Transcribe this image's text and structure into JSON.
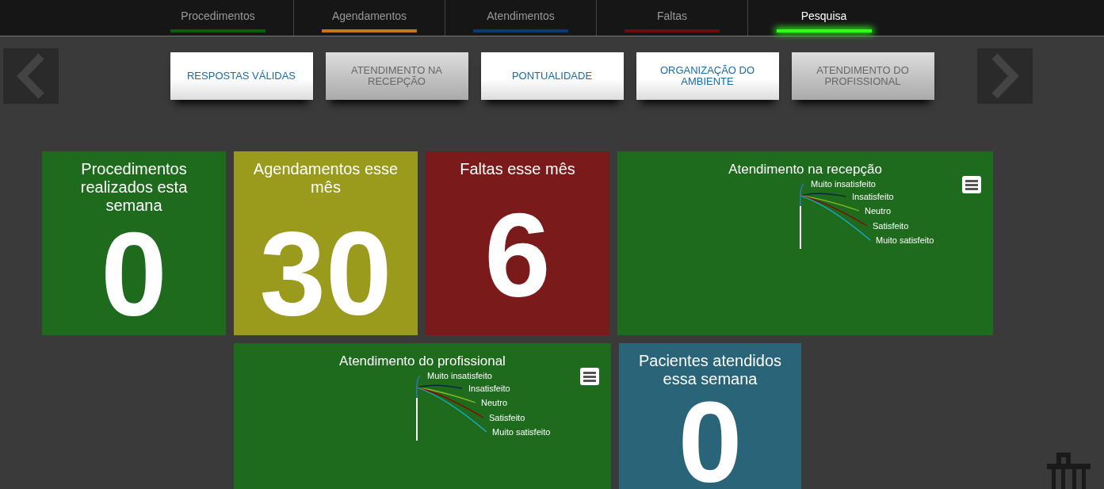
{
  "nav": {
    "tabs": [
      {
        "label": "Procedimentos",
        "color": "#0b5d0b",
        "selected": false
      },
      {
        "label": "Agendamentos",
        "color": "#c87810",
        "selected": false
      },
      {
        "label": "Atendimentos",
        "color": "#0c3a6e",
        "selected": false
      },
      {
        "label": "Faltas",
        "color": "#6e0b0b",
        "selected": false
      },
      {
        "label": "Pesquisa",
        "color": "#33ff1a",
        "selected": true
      }
    ]
  },
  "filters": [
    {
      "label": "RESPOSTAS VÁLIDAS",
      "selected": true
    },
    {
      "label": "ATENDIMENTO NA RECEPÇÃO",
      "selected": false
    },
    {
      "label": "PONTUALIDADE",
      "selected": true
    },
    {
      "label": "ORGANIZAÇÃO DO AMBIENTE",
      "selected": true
    },
    {
      "label": "ATENDIMENTO DO PROFISSIONAL",
      "selected": false
    }
  ],
  "tiles": [
    {
      "kind": "number",
      "title": "Procedimentos realizados esta semana",
      "value": "0",
      "color": "#1e6b1e"
    },
    {
      "kind": "number",
      "title": "Agendamentos esse mês",
      "value": "30",
      "color": "#9a9a1c"
    },
    {
      "kind": "number",
      "title": "Faltas esse mês",
      "value": "6",
      "color": "#7b1a1a"
    },
    {
      "kind": "chart",
      "title": "Atendimento na recepção",
      "color": "#1e6b1e",
      "slices": [
        {
          "label": "Muito insatisfeito",
          "color": "#2f7ed8"
        },
        {
          "label": "Insatisfeito",
          "color": "#0d233a"
        },
        {
          "label": "Neutro",
          "color": "#8bbc21"
        },
        {
          "label": "Satisfeito",
          "color": "#910000"
        },
        {
          "label": "Muito satisfeito",
          "color": "#1aadce"
        }
      ]
    },
    {
      "kind": "chart",
      "title": "Atendimento do profissional",
      "color": "#1e6b1e",
      "slices": [
        {
          "label": "Muito insatisfeito",
          "color": "#2f7ed8"
        },
        {
          "label": "Insatisfeito",
          "color": "#0d233a"
        },
        {
          "label": "Neutro",
          "color": "#8bbc21"
        },
        {
          "label": "Satisfeito",
          "color": "#910000"
        },
        {
          "label": "Muito satisfeito",
          "color": "#1aadce"
        }
      ]
    },
    {
      "kind": "number",
      "title": "Pacientes atendidos essa semana",
      "value": "0",
      "color": "#2a6478"
    }
  ]
}
